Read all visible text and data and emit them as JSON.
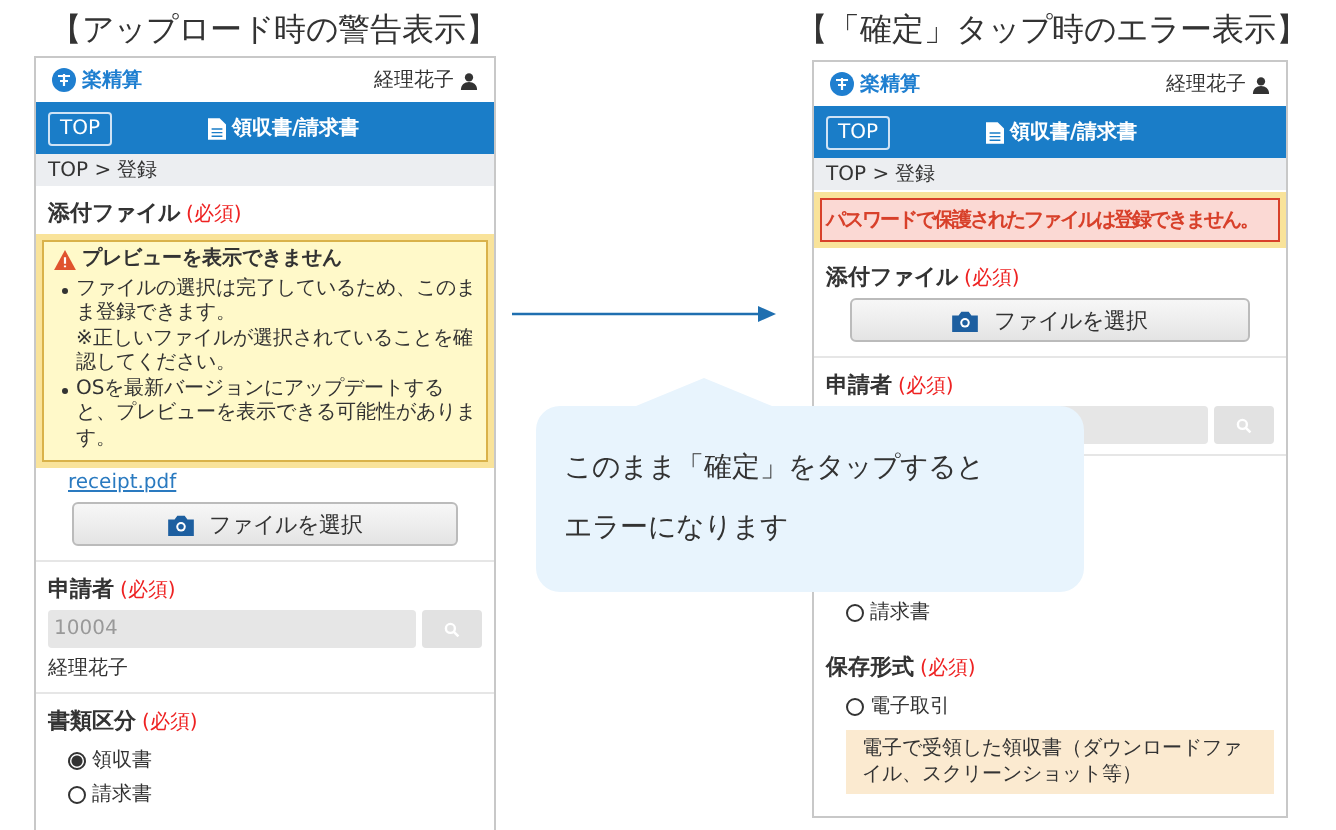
{
  "panels": [
    {
      "caption": "【アップロード時の警告表示】",
      "logo": "楽精算",
      "user_name": "経理花子",
      "top_button": "TOP",
      "page_title": "領収書/請求書",
      "breadcrumb": "TOP > 登録",
      "blocks": [
        {
          "kind": "file",
          "label": "添付ファイル",
          "required": "(必須)",
          "warning": {
            "highlight": true,
            "title": "プレビューを表示できません",
            "items": [
              {
                "text": "ファイルの選択は完了しているため、このまま登録できます。",
                "note": "※正しいファイルが選択されていることを確認してください。"
              },
              {
                "text": "OSを最新バージョンにアップデートすると、プレビューを表示できる可能性があります。"
              }
            ]
          },
          "file_name": "receipt.pdf",
          "button": "ファイルを選択"
        },
        {
          "kind": "applicant",
          "label": "申請者",
          "required": "(必須)",
          "value": "10004",
          "name": "経理花子"
        },
        {
          "kind": "radio",
          "label": "書類区分",
          "required": "(必須)",
          "options": [
            {
              "label": "領収書",
              "selected": true
            },
            {
              "label": "請求書",
              "selected": false
            }
          ]
        }
      ]
    },
    {
      "caption": "【「確定」タップ時のエラー表示】",
      "logo": "楽精算",
      "user_name": "経理花子",
      "top_button": "TOP",
      "page_title": "領収書/請求書",
      "breadcrumb": "TOP > 登録",
      "blocks": [
        {
          "kind": "error",
          "highlight": true,
          "text": "パスワードで保護されたファイルは登録できません。"
        },
        {
          "kind": "file",
          "label": "添付ファイル",
          "required": "(必須)",
          "button": "ファイルを選択"
        },
        {
          "kind": "applicant",
          "label": "申請者",
          "required": "(必須)"
        },
        {
          "kind": "radio",
          "options": [
            {
              "label": "請求書",
              "selected": false
            }
          ]
        },
        {
          "kind": "radio",
          "label": "保存形式",
          "required": "(必須)",
          "options": [
            {
              "label": "電子取引",
              "selected": false
            }
          ],
          "note": "電子で受領した領収書（ダウンロードファイル、スクリーンショット等）"
        }
      ]
    }
  ],
  "callout": {
    "lines": [
      "このまま「確定」をタップすると",
      "エラーになります"
    ]
  }
}
